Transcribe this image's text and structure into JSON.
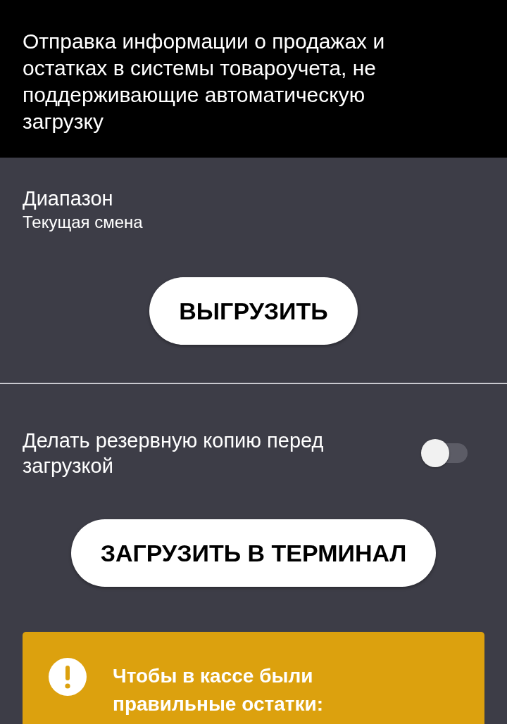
{
  "header": {
    "title": "Отправка информации о продажах и остатках в системы товароучета, не поддерживающие автоматическую загрузку"
  },
  "range": {
    "label": "Диапазон",
    "value": "Текущая смена"
  },
  "export_button": {
    "label": "ВЫГРУЗИТЬ"
  },
  "backup_toggle": {
    "label": "Делать резервную копию перед загрузкой",
    "on": false
  },
  "load_button": {
    "label": "ЗАГРУЗИТЬ В ТЕРМИНАЛ"
  },
  "warning": {
    "text": "Чтобы в кассе были правильные остатки:"
  }
}
